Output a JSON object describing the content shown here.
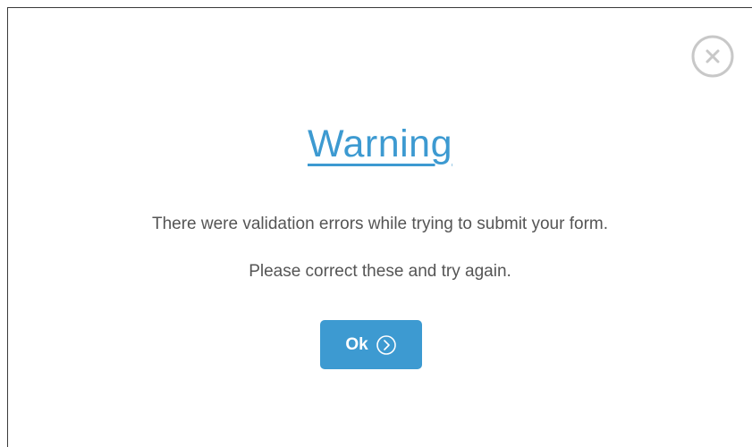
{
  "dialog": {
    "close_icon": "close-circle-icon",
    "title": "Warning",
    "message_line_1": "There were validation errors while trying to submit your form.",
    "message_line_2": "Please correct these and try again.",
    "ok_button": {
      "label": "Ok",
      "icon": "chevron-right-circle-icon"
    }
  },
  "colors": {
    "accent": "#3d9ad1",
    "text": "#555555",
    "close_icon": "#c8c8c8",
    "background": "#ffffff"
  }
}
